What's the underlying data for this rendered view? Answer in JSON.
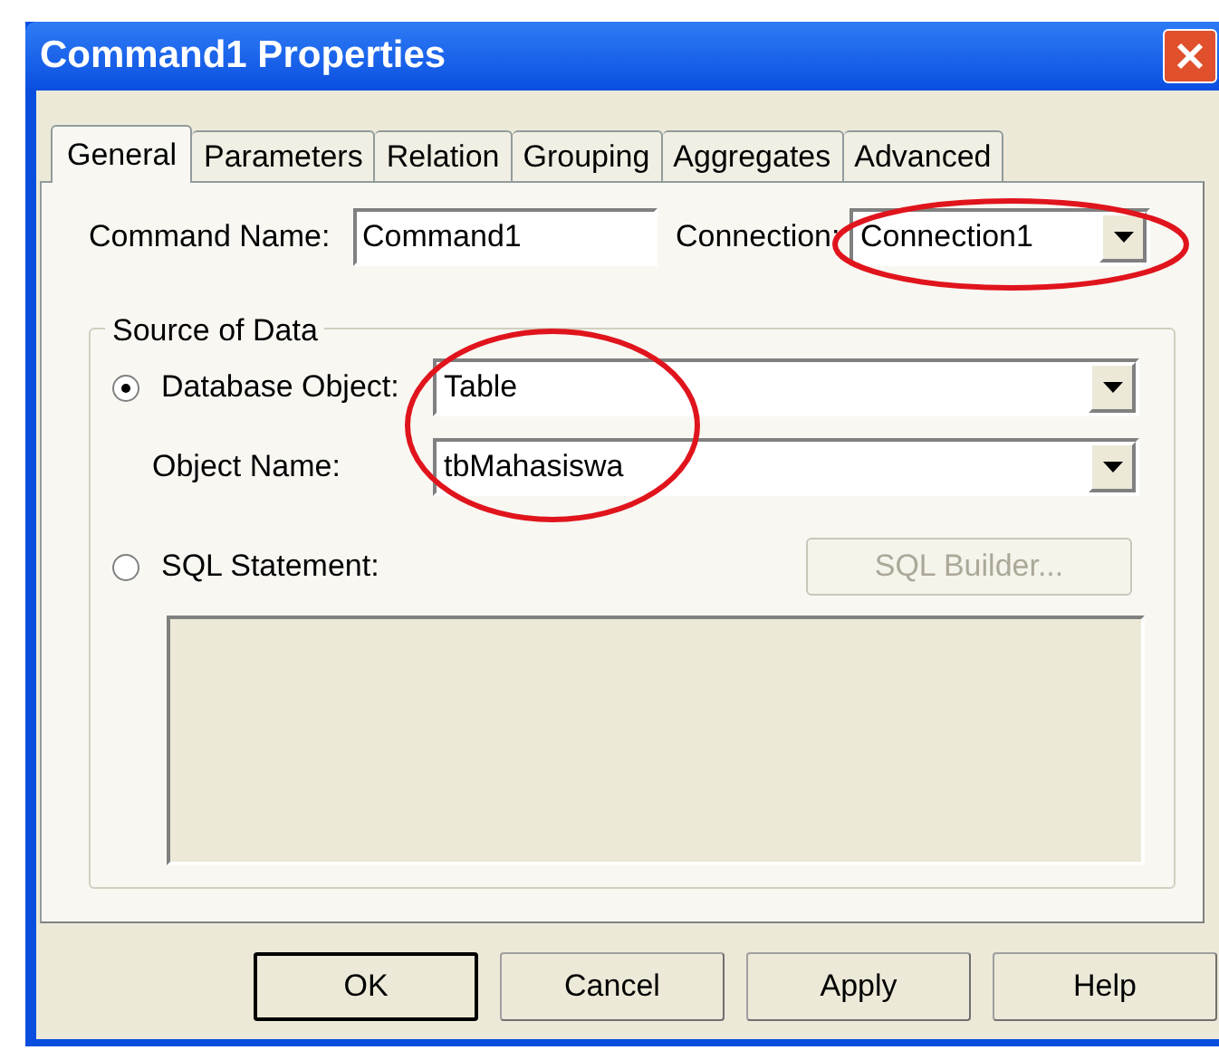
{
  "window": {
    "title": "Command1 Properties"
  },
  "tabs": [
    {
      "label": "General",
      "selected": true
    },
    {
      "label": "Parameters",
      "selected": false
    },
    {
      "label": "Relation",
      "selected": false
    },
    {
      "label": "Grouping",
      "selected": false
    },
    {
      "label": "Aggregates",
      "selected": false
    },
    {
      "label": "Advanced",
      "selected": false
    }
  ],
  "command_name": {
    "label": "Command Name:",
    "value": "Command1"
  },
  "connection": {
    "label": "Connection:",
    "value": "Connection1"
  },
  "source_of_data": {
    "title": "Source of Data",
    "database_object": {
      "label": "Database Object:",
      "selected": true,
      "value": "Table"
    },
    "object_name": {
      "label": "Object Name:",
      "value": "tbMahasiswa"
    },
    "sql_statement": {
      "label": "SQL Statement:",
      "selected": false
    },
    "sql_builder": {
      "label": "SQL Builder...",
      "disabled": true
    }
  },
  "buttons": [
    {
      "label": "OK",
      "default": true
    },
    {
      "label": "Cancel",
      "default": false
    },
    {
      "label": "Apply",
      "default": false
    },
    {
      "label": "Help",
      "default": false
    }
  ]
}
